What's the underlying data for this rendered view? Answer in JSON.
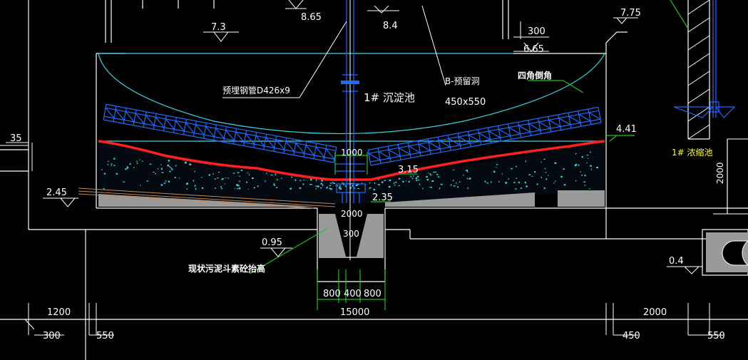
{
  "colors": {
    "background": "#000000",
    "structure": "#ffffff",
    "hatch_blue": "#1e6bff",
    "cyan": "#38d6e8",
    "red": "#ff2020",
    "green": "#1fc21f",
    "yellow": "#ffff33",
    "gray_fill": "#9a9a9a",
    "brown": "#c48a5a"
  },
  "elevations": {
    "top_left": "7.3",
    "top_mid1": "8.65",
    "top_mid2": "8.4",
    "right_upper": "7.75",
    "right_mid": "6.65",
    "slope_right": "4.41",
    "center_upper": "3.15",
    "center_lower": "2.35",
    "left_mid": "2.45",
    "bottom_left": "0.95",
    "far_right_low": "0.4"
  },
  "dimensions": {
    "top_300": "300",
    "left_35": "35",
    "center_1000": "1000",
    "pit_2000": "2000",
    "pit_300": "300",
    "seg_800_left": "800",
    "seg_400": "400",
    "seg_800_right": "800",
    "total_15000": "15000",
    "bottom_1200": "1200",
    "bottom_300": "300",
    "bottom_550_left": "550",
    "bottom_2000": "2000",
    "bottom_450": "450",
    "bottom_550_right": "550",
    "vert_2000": "2000"
  },
  "labels": {
    "embedded_pipe": "预埋钢管D426x9",
    "tank_name": "1# 沉淀池",
    "opening_tag": "B-预留洞",
    "opening_size": "450x550",
    "corner_chamfer": "四角倒角",
    "right_tank": "1# 浓缩池",
    "sludge_hopper_note": "现状污泥斗素砼抬高"
  }
}
